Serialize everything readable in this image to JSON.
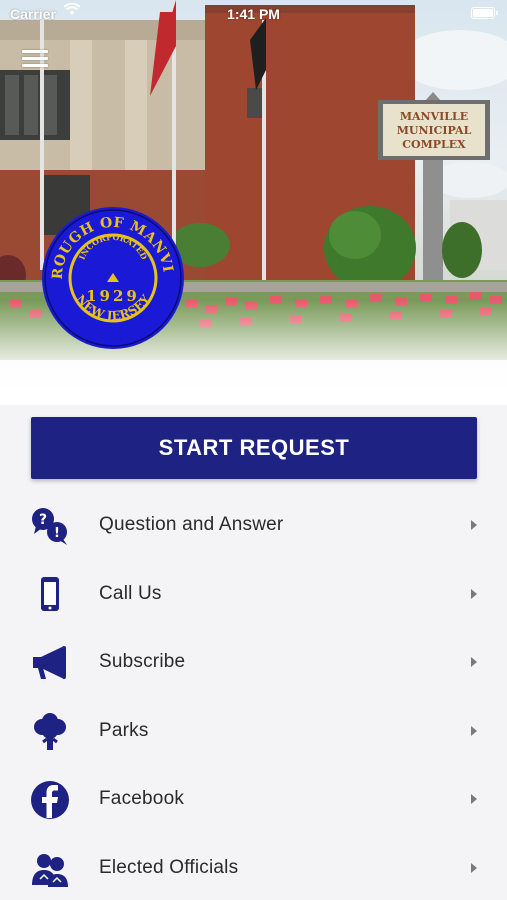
{
  "status_bar": {
    "carrier": "Carrier",
    "time": "1:41 PM"
  },
  "hero": {
    "sign_lines": [
      "MANVILLE",
      "MUNICIPAL",
      "COMPLEX"
    ],
    "seal": {
      "top_text": "BOROUGH OF MANVILLE",
      "middle_text": "INCORPORATED",
      "year": "1929",
      "bottom_text": "NEW JERSEY"
    }
  },
  "start_request": {
    "label": "START REQUEST"
  },
  "menu": {
    "items": [
      {
        "label": "Question and Answer",
        "icon": "question-answer-icon"
      },
      {
        "label": "Call Us",
        "icon": "phone-icon"
      },
      {
        "label": "Subscribe",
        "icon": "megaphone-icon"
      },
      {
        "label": "Parks",
        "icon": "tree-icon"
      },
      {
        "label": "Facebook",
        "icon": "facebook-icon"
      },
      {
        "label": "Elected Officials",
        "icon": "officials-icon"
      }
    ]
  },
  "colors": {
    "primary": "#1e2282",
    "seal_blue": "#1a1ad6",
    "seal_gold": "#e8c21a"
  }
}
